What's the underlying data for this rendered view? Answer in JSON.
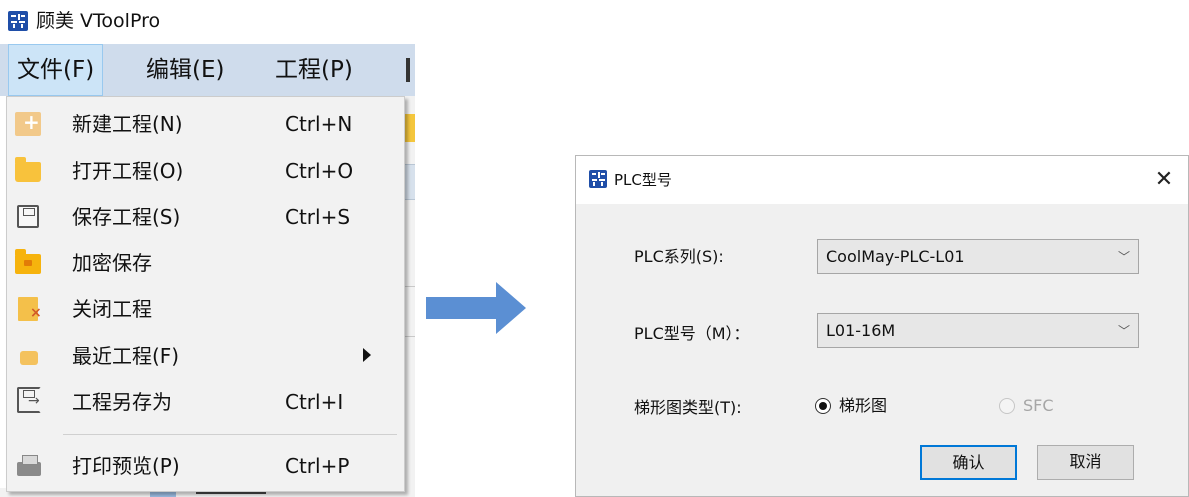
{
  "app": {
    "title": "顾美 VToolPro"
  },
  "menubar": {
    "items": [
      {
        "label": "文件(F)",
        "active": true
      },
      {
        "label": "编辑(E)",
        "active": false
      },
      {
        "label": "工程(P)",
        "active": false
      }
    ]
  },
  "file_menu": {
    "items": [
      {
        "label": "新建工程(N)",
        "shortcut": "Ctrl+N",
        "icon": "new-project-icon"
      },
      {
        "label": "打开工程(O)",
        "shortcut": "Ctrl+O",
        "icon": "folder-icon"
      },
      {
        "label": "保存工程(S)",
        "shortcut": "Ctrl+S",
        "icon": "save-icon"
      },
      {
        "label": "加密保存",
        "shortcut": "",
        "icon": "encrypted-folder-icon"
      },
      {
        "label": "关闭工程",
        "shortcut": "",
        "icon": "close-project-icon"
      },
      {
        "label": "最近工程(F)",
        "shortcut": "",
        "icon": "recent-projects-icon",
        "submenu": true
      },
      {
        "label": "工程另存为",
        "shortcut": "Ctrl+I",
        "icon": "save-as-icon"
      },
      {
        "label": "打印预览(P)",
        "shortcut": "Ctrl+P",
        "icon": "printer-icon"
      }
    ]
  },
  "dialog": {
    "title": "PLC型号",
    "series_label": "PLC系列(S):",
    "series_value": "CoolMay-PLC-L01",
    "model_label": "PLC型号（M）：",
    "model_value": "L01-16M",
    "ladder_type_label": "梯形图类型(T):",
    "ladder_options": [
      {
        "label": "梯形图",
        "checked": true,
        "enabled": true
      },
      {
        "label": "SFC",
        "checked": false,
        "enabled": false
      }
    ],
    "ok_label": "确认",
    "cancel_label": "取消"
  },
  "colors": {
    "menubar_bg": "#cfdcec",
    "menu_bg": "#f2f2f2",
    "dialog_bg": "#f0f0f0",
    "arrow": "#5b8fd3",
    "default_button_border": "#0078d7",
    "app_icon": "#1f4ea8"
  }
}
